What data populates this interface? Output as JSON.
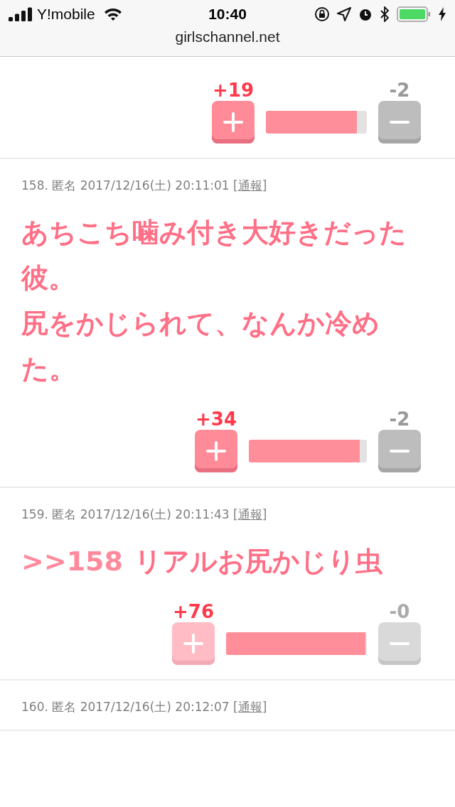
{
  "status_bar": {
    "carrier": "Y!mobile",
    "time": "10:40"
  },
  "address_bar": {
    "domain": "girlschannel.net"
  },
  "posts": [
    {
      "votes": {
        "plus": "+19",
        "minus": "-2",
        "level": 0.9,
        "disabled": false
      }
    },
    {
      "number": "158.",
      "author": "匿名",
      "date": "2017/12/16(土) 20:11:01",
      "bracket_open": "[",
      "report": "通報",
      "bracket_close": "]",
      "lines": [
        "あちこち噛み付き大好きだった彼。",
        "尻をかじられて、なんか冷めた。"
      ],
      "votes": {
        "plus": "+34",
        "minus": "-2",
        "level": 0.94,
        "disabled": false
      }
    },
    {
      "number": "159.",
      "author": "匿名",
      "date": "2017/12/16(土) 20:11:43",
      "bracket_open": "[",
      "report": "通報",
      "bracket_close": "]",
      "anchor": ">>158",
      "lines": [
        "リアルお尻かじり虫"
      ],
      "votes": {
        "plus": "+76",
        "minus": "-0",
        "level": 0.99,
        "disabled": true
      }
    },
    {
      "number": "160.",
      "author": "匿名",
      "date": "2017/12/16(土) 20:12:07",
      "bracket_open": "[",
      "report": "通報",
      "bracket_close": "]"
    }
  ]
}
